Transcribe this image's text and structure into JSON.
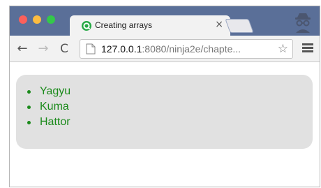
{
  "colors": {
    "tabstrip": "#5a6f98",
    "traffic_close": "#fc605b",
    "traffic_minimize": "#fdbc40",
    "traffic_maximize": "#34c84a",
    "list_text": "#1b8a1b",
    "list_background": "#e1e1e1"
  },
  "tab": {
    "title": "Creating arrays",
    "close_label": "×",
    "favicon": "circle-favicon-icon"
  },
  "toolbar": {
    "back_icon": "←",
    "forward_icon": "→",
    "reload_icon": "C",
    "bookmark_icon": "☆",
    "menu_icon": "hamburger-menu-icon"
  },
  "address": {
    "host": "127.0.0.1",
    "rest": ":8080/ninja2e/chapte..."
  },
  "page": {
    "items": [
      "Yagyu",
      "Kuma",
      "Hattor"
    ]
  }
}
